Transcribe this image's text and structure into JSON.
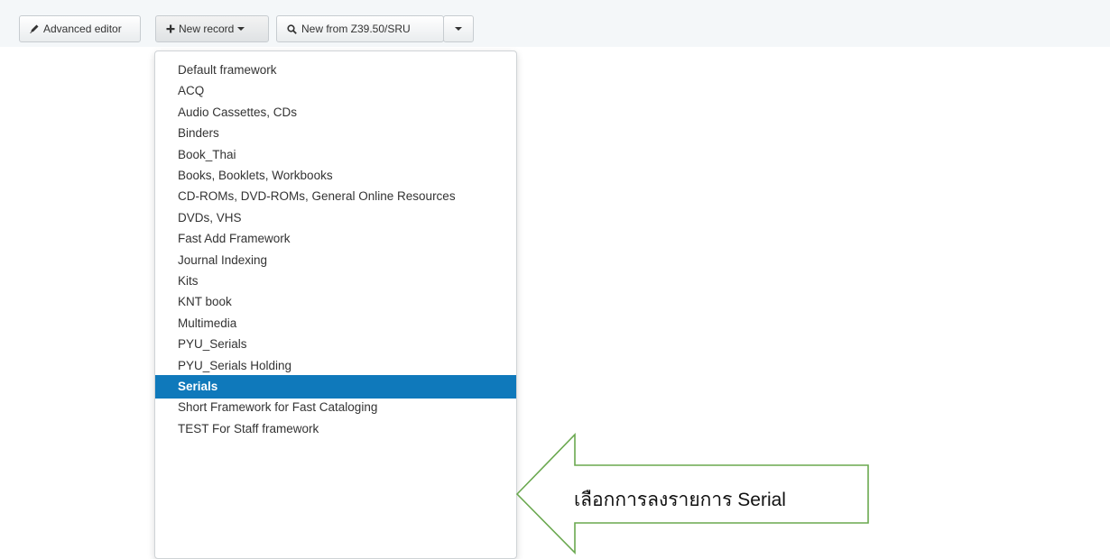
{
  "toolbar": {
    "advanced_editor": "Advanced editor",
    "new_record": "New record",
    "new_from_z3950": "New from Z39.50/SRU"
  },
  "menu": {
    "items": [
      "Default framework",
      "ACQ",
      "Audio Cassettes, CDs",
      "Binders",
      "Book_Thai",
      "Books, Booklets, Workbooks",
      "CD-ROMs, DVD-ROMs, General Online Resources",
      "DVDs, VHS",
      "Fast Add Framework",
      "Journal Indexing",
      "Kits",
      "KNT book",
      "Multimedia",
      "PYU_Serials",
      "PYU_Serials Holding",
      "Serials",
      "Short Framework for Fast Cataloging",
      "TEST For Staff framework"
    ],
    "selected_index": 15
  },
  "callout": {
    "text": "เลือกการลงรายการ Serial",
    "color": "#6aa84f"
  },
  "colors": {
    "accent": "#0f79bb"
  }
}
